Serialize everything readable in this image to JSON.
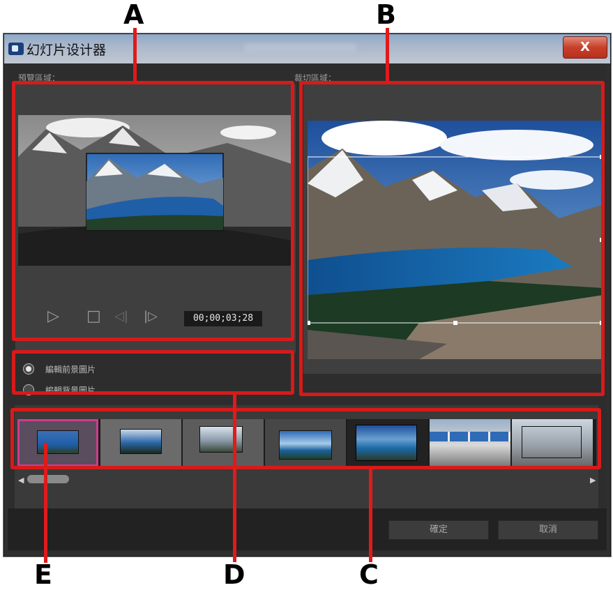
{
  "callouts": {
    "a": "A",
    "b": "B",
    "c": "C",
    "d": "D",
    "e": "E"
  },
  "window": {
    "title": "幻灯片设计器",
    "close_label": "X"
  },
  "preview": {
    "label": "預覽區域：",
    "timecode": "00;00;03;28",
    "controls": {
      "play": "▷",
      "stop": "□",
      "prev_frame": "◁|",
      "next_frame": "|▷"
    }
  },
  "crop": {
    "label": "裁切區域："
  },
  "edit_options": [
    {
      "label": "編輯前景圖片",
      "selected": true
    },
    {
      "label": "編輯背景圖片",
      "selected": false
    }
  ],
  "thumbnails": {
    "count": 7,
    "selected_index": 0
  },
  "scrollbar": {
    "left_arrow": "◀",
    "right_arrow": "▶"
  },
  "buttons": {
    "confirm": "確定",
    "cancel": "取消"
  },
  "colors": {
    "callout_red": "#d71a1a",
    "selection_pink": "#d03c8c",
    "window_bg": "#2d2d2d"
  }
}
